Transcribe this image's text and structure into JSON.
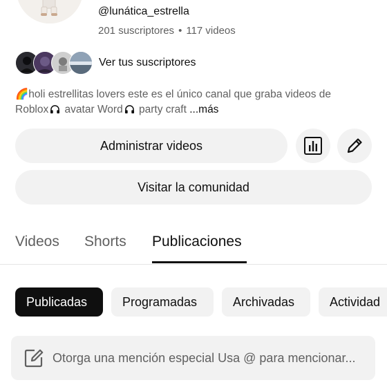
{
  "channel": {
    "handle": "@lunática_estrella",
    "subscribers": "201 suscriptores",
    "separator": "•",
    "videos": "117 videos",
    "view_subscribers": "Ver tus suscriptores",
    "description_line1": "🌈holi estrellitas lovers  este es el único canal que graba videos de",
    "description_line2a": "Roblox",
    "description_line2b": " avatar Word",
    "description_line2c": "  party craft ",
    "description_more": "...más"
  },
  "actions": {
    "manage_videos": "Administrar videos",
    "visit_community": "Visitar la comunidad"
  },
  "tabs": [
    {
      "label": "Videos",
      "active": false
    },
    {
      "label": "Shorts",
      "active": false
    },
    {
      "label": "Publicaciones",
      "active": true
    }
  ],
  "chips": [
    {
      "label": "Publicadas",
      "active": true
    },
    {
      "label": "Programadas",
      "active": false
    },
    {
      "label": "Archivadas",
      "active": false
    },
    {
      "label": "Actividad",
      "active": false
    }
  ],
  "post_input": {
    "placeholder": "Otorga una mención especial Usa @ para mencionar..."
  },
  "icons": {
    "stats": "bar-chart-icon",
    "edit": "pencil-icon",
    "compose": "compose-icon",
    "headphones": "headphones-icon"
  }
}
